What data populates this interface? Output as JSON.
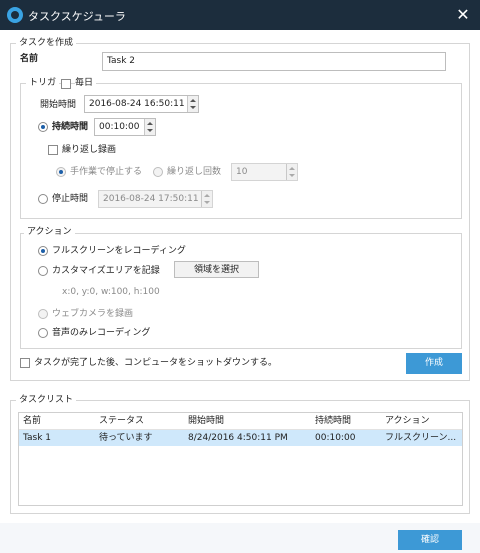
{
  "window": {
    "title": "タスクスケジューラ"
  },
  "create": {
    "group_label": "タスクを作成",
    "name_label": "名前",
    "name_value": "Task 2",
    "trigger_label": "トリガ",
    "daily_label": "毎日",
    "start_time_label": "開始時間",
    "start_time_value": "2016-08-24 16:50:11",
    "duration_label": "持続時間",
    "duration_value": "00:10:00",
    "repeat_label": "繰り返し録画",
    "manual_stop_label": "手作業で停止する",
    "repeat_count_label": "繰り返し回数",
    "repeat_count_value": "10",
    "stop_time_label": "停止時間",
    "stop_time_value": "2016-08-24 17:50:11",
    "action_label": "アクション",
    "fullscreen_label": "フルスクリーンをレコーディング",
    "custom_area_label": "カスタマイズエリアを記録",
    "select_area_button": "領域を選択",
    "area_coords": "x:0, y:0, w:100, h:100",
    "webcam_label": "ウェブカメラを録画",
    "audio_only_label": "音声のみレコーディング",
    "shutdown_label": "タスクが完了した後、コンピュータをショットダウンする。",
    "create_button": "作成"
  },
  "task_list": {
    "group_label": "タスクリスト",
    "columns": [
      "名前",
      "ステータス",
      "開始時間",
      "持続時間",
      "アクション"
    ],
    "rows": [
      [
        "Task 1",
        "待っています",
        "8/24/2016 4:50:11 PM",
        "00:10:00",
        "フルスクリーン..."
      ]
    ]
  },
  "confirm_button": "確認",
  "colors": {
    "titlebar": "#1c2d3d",
    "accent": "#3d99d6",
    "selected_row": "#cfe8fb"
  },
  "icons": {
    "logo": "camera-logo-icon",
    "close": "close-icon"
  }
}
